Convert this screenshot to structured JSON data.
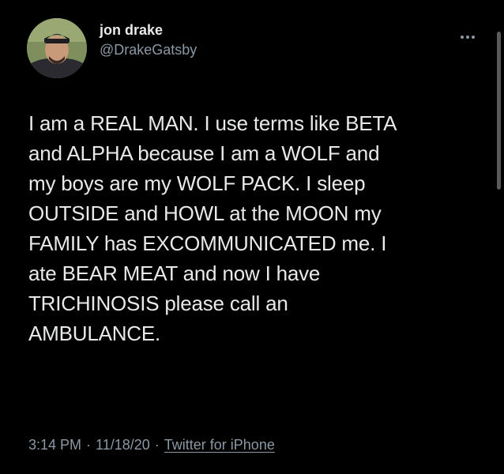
{
  "tweet": {
    "author": {
      "display_name": "jon drake",
      "handle": "@DrakeGatsby"
    },
    "text": "I am a REAL MAN. I use terms like BETA\nand ALPHA because I am a WOLF and\nmy boys are my WOLF PACK. I sleep\nOUTSIDE and HOWL at the MOON my\nFAMILY has EXCOMMUNICATED me. I\nate BEAR MEAT and now I have\nTRICHINOSIS please call an\nAMBULANCE.",
    "time": "3:14 PM",
    "date": "11/18/20",
    "separator": "·",
    "source": "Twitter for iPhone"
  },
  "icons": {
    "more": "more-options-icon"
  },
  "colors": {
    "background": "#000000",
    "text": "#e7e9ea",
    "secondary_text": "#8b98a5"
  }
}
